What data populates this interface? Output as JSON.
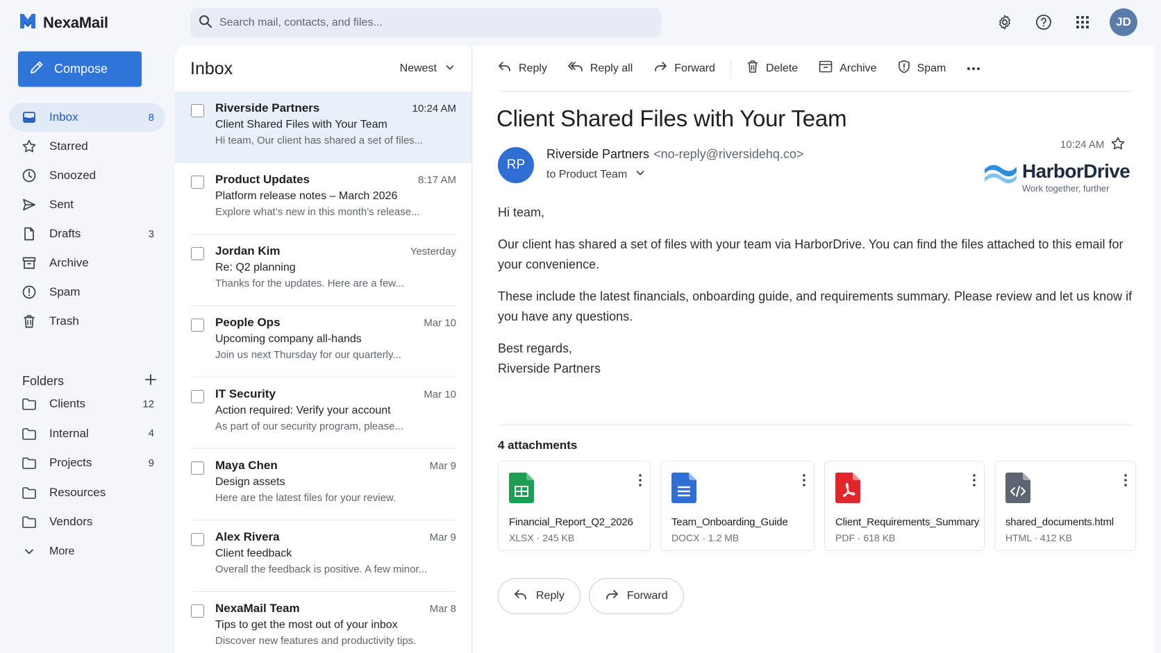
{
  "app": {
    "name": "NexaMail",
    "brand_color": "#2f74d8"
  },
  "search": {
    "placeholder": "Search mail, contacts, and files..."
  },
  "topbar": {
    "avatar_initials": "JD"
  },
  "sidebar": {
    "compose_label": "Compose",
    "items": [
      {
        "label": "Inbox",
        "count": "8",
        "icon": "inbox-icon",
        "active": true
      },
      {
        "label": "Starred",
        "count": "",
        "icon": "star-icon"
      },
      {
        "label": "Snoozed",
        "count": "",
        "icon": "clock-icon"
      },
      {
        "label": "Sent",
        "count": "",
        "icon": "send-icon"
      },
      {
        "label": "Drafts",
        "count": "3",
        "icon": "draft-icon"
      },
      {
        "label": "Archive",
        "count": "",
        "icon": "archive-icon"
      },
      {
        "label": "Spam",
        "count": "",
        "icon": "spam-icon"
      },
      {
        "label": "Trash",
        "count": "",
        "icon": "trash-icon"
      }
    ],
    "folders_heading": "Folders",
    "folders": [
      {
        "label": "Clients",
        "count": "12"
      },
      {
        "label": "Internal",
        "count": "4"
      },
      {
        "label": "Projects",
        "count": "9"
      },
      {
        "label": "Resources",
        "count": ""
      },
      {
        "label": "Vendors",
        "count": ""
      }
    ],
    "more_label": "More"
  },
  "list": {
    "title": "Inbox",
    "sort_label": "Newest",
    "messages": [
      {
        "sender": "Riverside Partners",
        "time": "10:24 AM",
        "subject": "Client Shared Files with Your Team",
        "preview": "Hi team, Our client has shared a set of files...",
        "active": true
      },
      {
        "sender": "Product Updates",
        "time": "8:17 AM",
        "subject": "Platform release notes – March 2026",
        "preview": "Explore what’s new in this month’s release..."
      },
      {
        "sender": "Jordan Kim",
        "time": "Yesterday",
        "subject": "Re: Q2 planning",
        "preview": "Thanks for the updates. Here are a few..."
      },
      {
        "sender": "People Ops",
        "time": "Mar 10",
        "subject": "Upcoming company all-hands",
        "preview": "Join us next Thursday for our quarterly..."
      },
      {
        "sender": "IT Security",
        "time": "Mar 10",
        "subject": "Action required: Verify your account",
        "preview": "As part of our security program, please..."
      },
      {
        "sender": "Maya Chen",
        "time": "Mar 9",
        "subject": "Design assets",
        "preview": "Here are the latest files for your review."
      },
      {
        "sender": "Alex Rivera",
        "time": "Mar 9",
        "subject": "Client feedback",
        "preview": "Overall the feedback is positive. A few minor..."
      },
      {
        "sender": "NexaMail Team",
        "time": "Mar 8",
        "subject": "Tips to get the most out of your inbox",
        "preview": "Discover new features and productivity tips."
      }
    ]
  },
  "toolbar": {
    "reply": "Reply",
    "reply_all": "Reply all",
    "forward": "Forward",
    "delete": "Delete",
    "archive": "Archive",
    "spam": "Spam"
  },
  "email": {
    "subject": "Client Shared Files with Your Team",
    "avatar_initials": "RP",
    "sender_name": "Riverside Partners",
    "sender_email": "<no-reply@riversidehq.co>",
    "to": "to Product Team",
    "time": "10:24 AM",
    "logo_name": "HarborDrive",
    "logo_tagline": "Work together, further",
    "greeting": "Hi team,",
    "para1": "Our client has shared a set of files with your team via HarborDrive. You can find the files attached to this email for your convenience.",
    "para2": "These include the latest financials, onboarding guide, and requirements summary. Please review and let us know if you have any questions.",
    "signoff1": "Best regards,",
    "signoff2": "Riverside Partners",
    "attachments_title": "4 attachments",
    "attachments": [
      {
        "name": "Financial_Report_Q2_2026",
        "meta": "XLSX · 245 KB",
        "type": "xlsx",
        "color": "#1e9e55"
      },
      {
        "name": "Team_Onboarding_Guide",
        "meta": "DOCX · 1.2 MB",
        "type": "docx",
        "color": "#2f6fd3"
      },
      {
        "name": "Client_Requirements_Summary",
        "meta": "PDF · 618 KB",
        "type": "pdf",
        "color": "#e0262b"
      },
      {
        "name": "shared_documents.html",
        "meta": "HTML · 412 KB",
        "type": "html",
        "color": "#5c6672"
      }
    ],
    "reply_btn": "Reply",
    "forward_btn": "Forward"
  }
}
